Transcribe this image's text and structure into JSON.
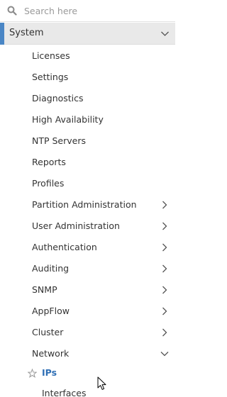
{
  "search": {
    "placeholder": "Search here",
    "icon": "search-icon"
  },
  "section": {
    "label": "System",
    "accent_color": "#4a86c5",
    "expanded": true
  },
  "items": [
    {
      "label": "Licenses",
      "has_children": false
    },
    {
      "label": "Settings",
      "has_children": false
    },
    {
      "label": "Diagnostics",
      "has_children": false
    },
    {
      "label": "High Availability",
      "has_children": false
    },
    {
      "label": "NTP Servers",
      "has_children": false
    },
    {
      "label": "Reports",
      "has_children": false
    },
    {
      "label": "Profiles",
      "has_children": false
    },
    {
      "label": "Partition Administration",
      "has_children": true
    },
    {
      "label": "User Administration",
      "has_children": true
    },
    {
      "label": "Authentication",
      "has_children": true
    },
    {
      "label": "Auditing",
      "has_children": true
    },
    {
      "label": "SNMP",
      "has_children": true
    },
    {
      "label": "AppFlow",
      "has_children": true
    },
    {
      "label": "Cluster",
      "has_children": true
    },
    {
      "label": "Network",
      "has_children": true,
      "expanded": true
    }
  ],
  "network_children": [
    {
      "label": "IPs",
      "active": true,
      "icon": "star-icon"
    },
    {
      "label": "Interfaces",
      "active": false
    }
  ],
  "colors": {
    "active_link": "#2f6fb5",
    "text": "#333333",
    "section_bg": "#e9e9e9"
  }
}
